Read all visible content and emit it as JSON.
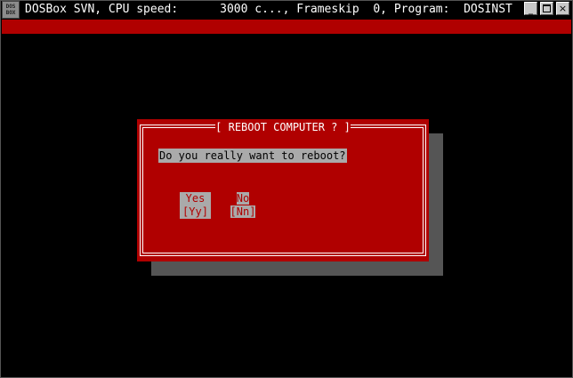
{
  "window": {
    "icon_text_top": "DOS",
    "icon_text_bottom": "BOX",
    "title": "DOSBox SVN, CPU speed:      3000 c..., Frameskip  0, Program:  DOSINST",
    "minimize_label": "_",
    "close_label": "×"
  },
  "dialog": {
    "title": "[ REBOOT COMPUTER ? ]",
    "question": "Do you really want to reboot?",
    "yes_label": "Yes",
    "yes_key": "[Yy]",
    "no_label": "No",
    "no_key": "[Nn]"
  },
  "colors": {
    "dos_red": "#b00000",
    "dos_gray": "#aaaaaa",
    "shadow": "#555555"
  }
}
